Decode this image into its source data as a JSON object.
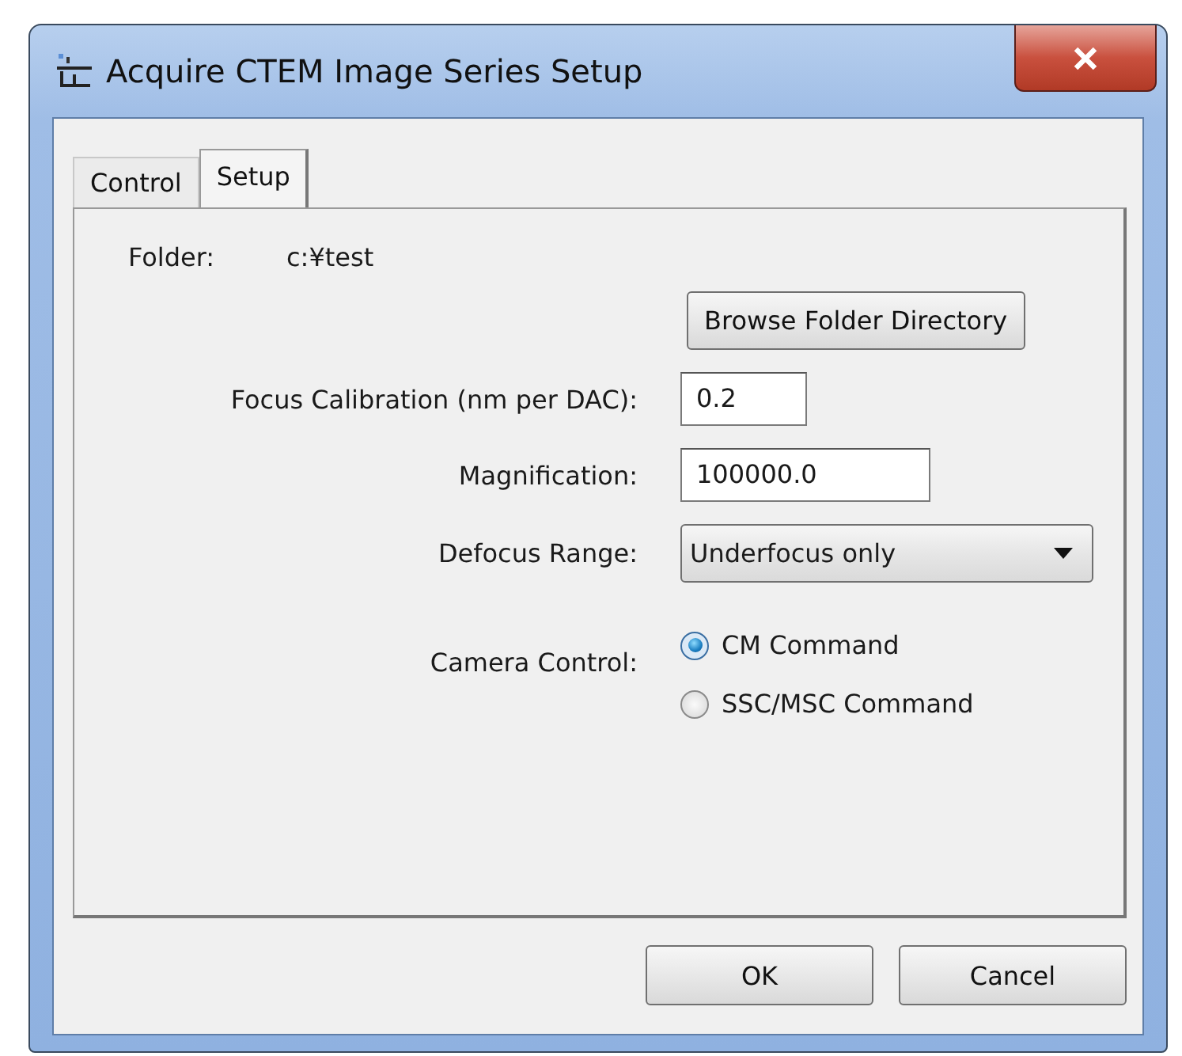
{
  "window": {
    "title": "Acquire CTEM Image Series Setup"
  },
  "tabs": [
    {
      "label": "Control",
      "selected": false
    },
    {
      "label": "Setup",
      "selected": true
    }
  ],
  "folder": {
    "label": "Folder:",
    "value": "c:¥test"
  },
  "browse_button": "Browse Folder Directory",
  "fields": [
    {
      "label": "Focus Calibration (nm per DAC):",
      "value": "0.2",
      "kind": "short"
    },
    {
      "label": "Magnification:",
      "value": "100000.0",
      "kind": "long"
    },
    {
      "label": "Defocus Range:",
      "value": "Underfocus only",
      "kind": "dropdown"
    }
  ],
  "camera_control": {
    "label": "Camera Control:",
    "options": [
      {
        "label": "CM Command",
        "selected": true
      },
      {
        "label": "SSC/MSC Command",
        "selected": false
      }
    ]
  },
  "buttons": [
    "OK",
    "Cancel"
  ]
}
